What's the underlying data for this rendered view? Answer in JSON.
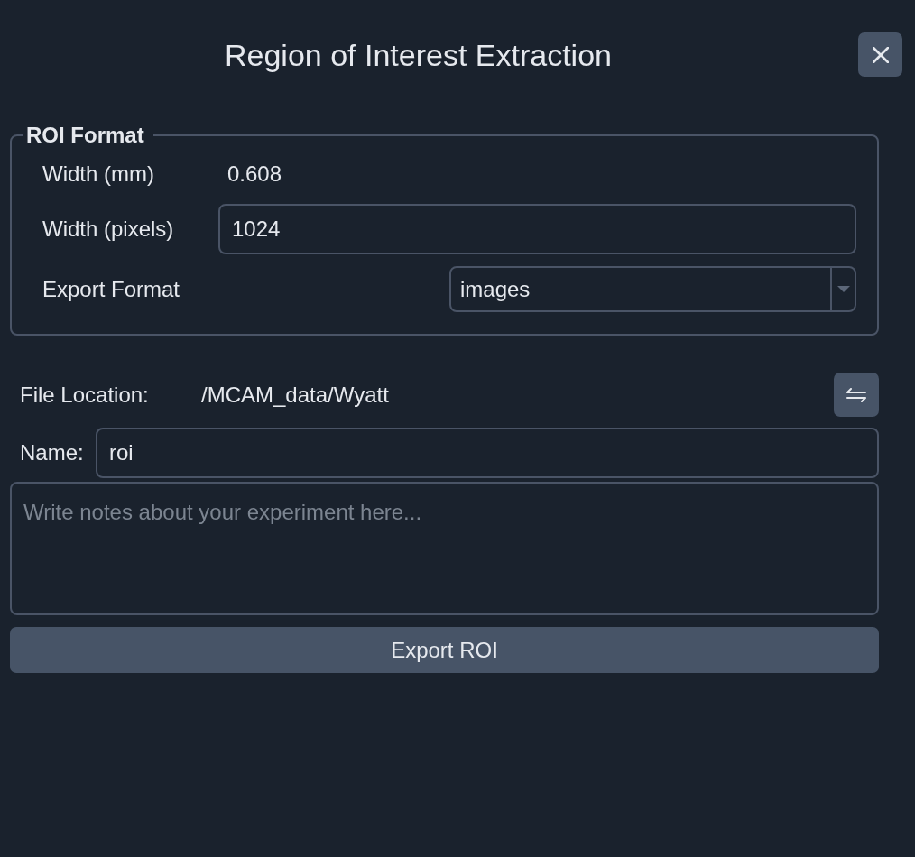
{
  "title": "Region of Interest Extraction",
  "roi_format": {
    "legend": "ROI Format",
    "fields": [
      {
        "kind": "readout",
        "label": "Width (mm)",
        "value": "0.608"
      },
      {
        "kind": "input",
        "label": "Width (pixels)",
        "value": "1024"
      },
      {
        "kind": "select",
        "label": "Export Format",
        "value": "images"
      }
    ]
  },
  "file_location": {
    "label": "File Location:",
    "value": "/MCAM_data/Wyatt"
  },
  "name": {
    "label": "Name:",
    "value": "roi"
  },
  "notes": {
    "placeholder": "Write notes about your experiment here..."
  },
  "export_button": {
    "label": "Export ROI"
  }
}
